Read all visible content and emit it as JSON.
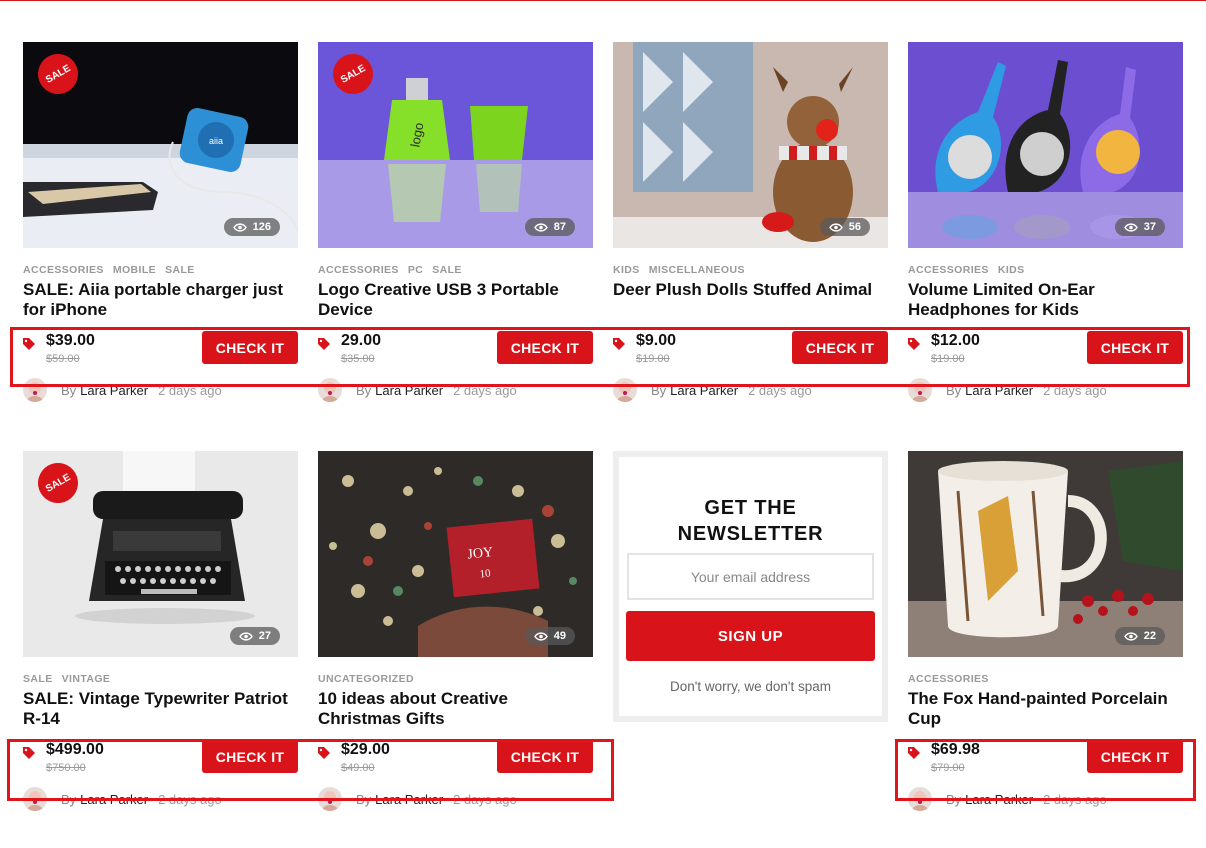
{
  "theme": {
    "accent": "#d8141a",
    "highlight_border": "#e0141a"
  },
  "badge_text": "SALE",
  "currency_icon": "price-tag-icon",
  "posts": [
    {
      "categories": [
        "ACCESSORIES",
        "MOBILE",
        "SALE"
      ],
      "title": "SALE: Aiia portable charger just for iPhone",
      "price": "$39.00",
      "old_price": "$59.00",
      "button": "CHECK IT",
      "views": "126",
      "sale": true,
      "author_prefix": "By",
      "author": "Lara Parker",
      "date": "2 days ago"
    },
    {
      "categories": [
        "ACCESSORIES",
        "PC",
        "SALE"
      ],
      "title": "Logo Creative USB 3 Portable Device",
      "price": "29.00",
      "old_price": "$35.00",
      "button": "CHECK IT",
      "views": "87",
      "sale": true,
      "author_prefix": "By",
      "author": "Lara Parker",
      "date": "2 days ago"
    },
    {
      "categories": [
        "KIDS",
        "MISCELLANEOUS"
      ],
      "title": "Deer Plush Dolls Stuffed Animal",
      "price": "$9.00",
      "old_price": "$19.00",
      "button": "CHECK IT",
      "views": "56",
      "sale": false,
      "author_prefix": "By",
      "author": "Lara Parker",
      "date": "2 days ago"
    },
    {
      "categories": [
        "ACCESSORIES",
        "KIDS"
      ],
      "title": "Volume Limited On-Ear Headphones for Kids",
      "price": "$12.00",
      "old_price": "$19.00",
      "button": "CHECK IT",
      "views": "37",
      "sale": false,
      "author_prefix": "By",
      "author": "Lara Parker",
      "date": "2 days ago"
    },
    {
      "categories": [
        "SALE",
        "VINTAGE"
      ],
      "title": "SALE: Vintage Typewriter Patriot R-14",
      "price": "$499.00",
      "old_price": "$750.00",
      "button": "CHECK IT",
      "views": "27",
      "sale": true,
      "author_prefix": "By",
      "author": "Lara Parker",
      "date": "2 days ago"
    },
    {
      "categories": [
        "UNCATEGORIZED"
      ],
      "title": "10 ideas about Creative Christmas Gifts",
      "price": "$29.00",
      "old_price": "$49.00",
      "button": "CHECK IT",
      "views": "49",
      "sale": false,
      "author_prefix": "By",
      "author": "Lara Parker",
      "date": "2 days ago"
    },
    {
      "categories": [
        "ACCESSORIES"
      ],
      "title": "The Fox Hand-painted Porcelain Cup",
      "price": "$69.98",
      "old_price": "$79.00",
      "button": "CHECK IT",
      "views": "22",
      "sale": false,
      "author_prefix": "By",
      "author": "Lara Parker",
      "date": "2 days ago"
    }
  ],
  "newsletter": {
    "title_line1": "GET THE",
    "title_line2": "NEWSLETTER",
    "email_placeholder": "Your email address",
    "button": "SIGN UP",
    "note": "Don't worry, we don't spam"
  }
}
